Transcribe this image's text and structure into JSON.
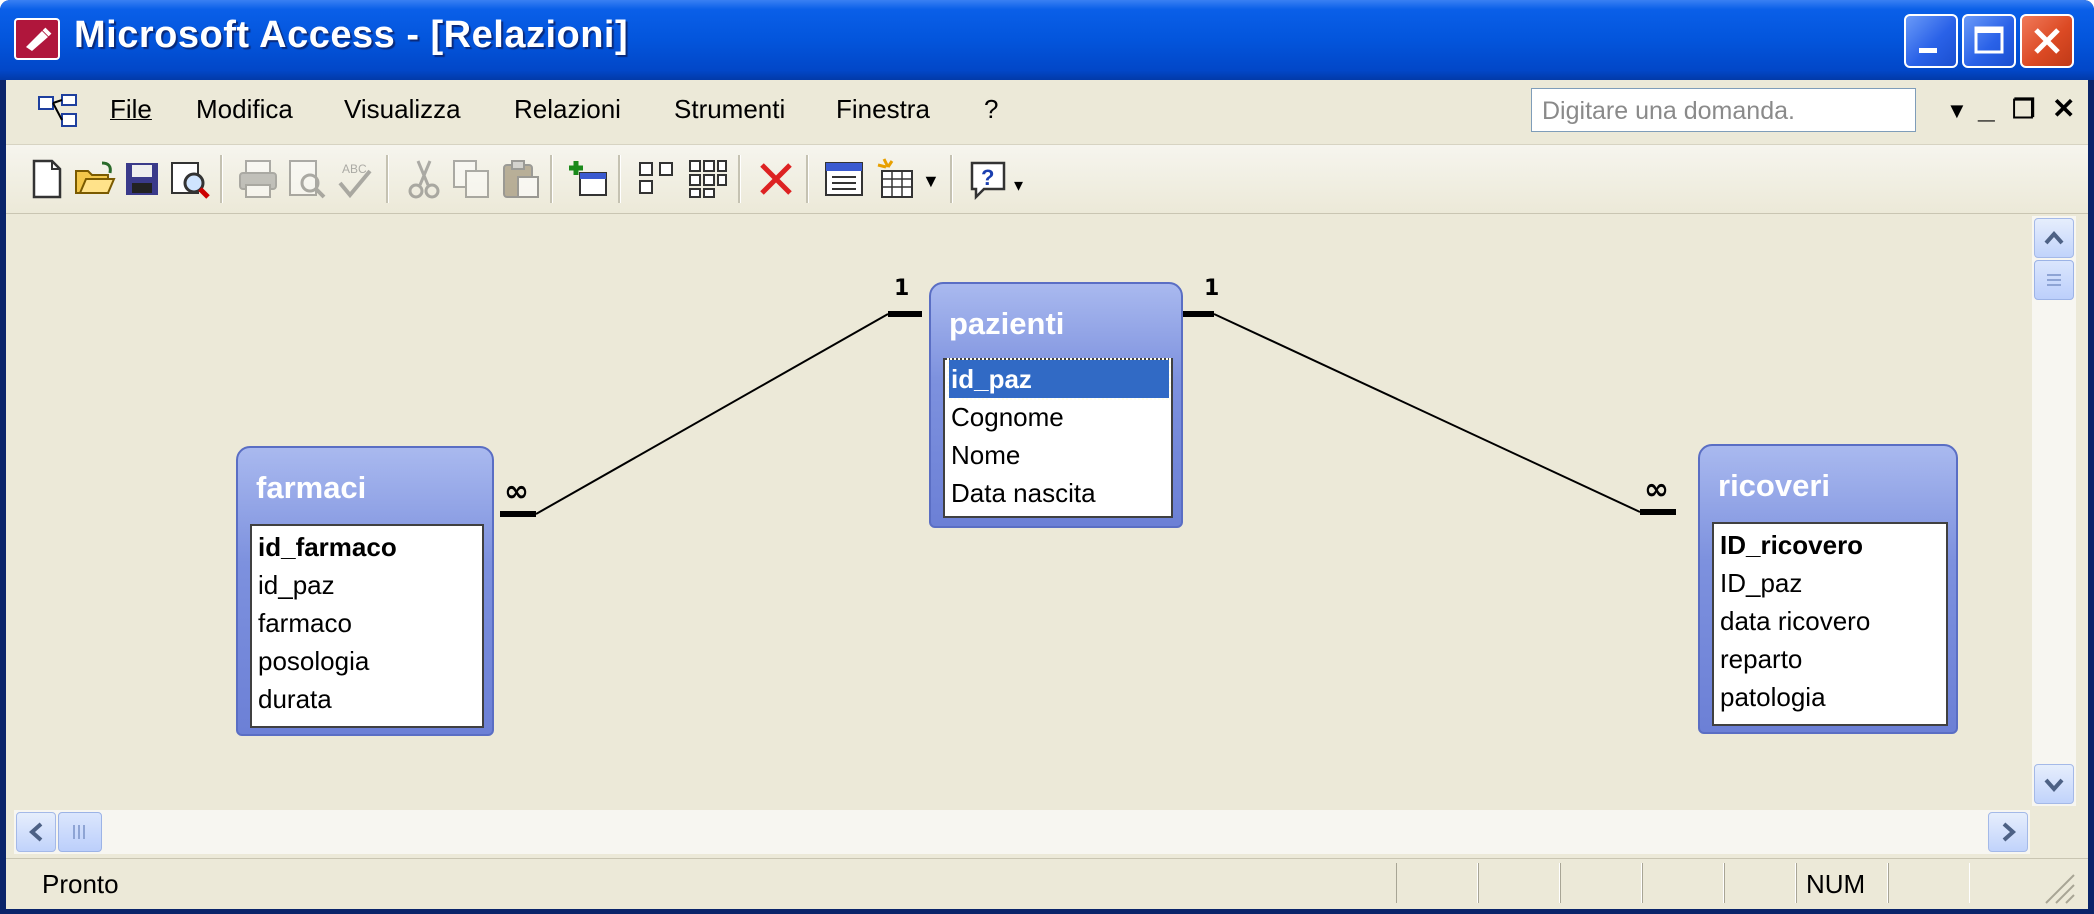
{
  "window": {
    "title": "Microsoft Access - [Relazioni]",
    "app_icon": "access-key-icon"
  },
  "menu": {
    "items": [
      "File",
      "Modifica",
      "Visualizza",
      "Relazioni",
      "Strumenti",
      "Finestra",
      "?"
    ],
    "ask_placeholder": "Digitare una domanda."
  },
  "toolbar": {
    "icons": [
      "new-icon",
      "open-icon",
      "save-icon",
      "search-icon",
      "print-icon",
      "print-preview-icon",
      "spelling-icon",
      "cut-icon",
      "copy-icon",
      "paste-icon",
      "show-table-icon",
      "direct-relationships-icon",
      "all-relationships-icon",
      "delete-icon",
      "database-window-icon",
      "new-object-icon",
      "help-icon"
    ]
  },
  "tables": [
    {
      "name": "farmaci",
      "fields": [
        "id_farmaco",
        "id_paz",
        "farmaco",
        "posologia",
        "durata"
      ],
      "primary_key": "id_farmaco"
    },
    {
      "name": "pazienti",
      "fields": [
        "id_paz",
        "Cognome",
        "Nome",
        "Data nascita"
      ],
      "primary_key": "id_paz",
      "selected": "id_paz"
    },
    {
      "name": "ricoveri",
      "fields": [
        "ID_ricovero",
        "ID_paz",
        "data ricovero",
        "reparto",
        "patologia"
      ],
      "primary_key": "ID_ricovero"
    }
  ],
  "relationships": [
    {
      "from": "pazienti.id_paz",
      "from_card": "1",
      "to": "farmaci.id_paz",
      "to_card": "∞"
    },
    {
      "from": "pazienti.id_paz",
      "from_card": "1",
      "to": "ricoveri.ID_paz",
      "to_card": "∞"
    }
  ],
  "status": {
    "text": "Pronto",
    "num": "NUM"
  },
  "colors": {
    "titlebar": "#0355dc",
    "table_header": "#7d91de",
    "selection": "#316ac5",
    "face": "#ece9d8"
  }
}
